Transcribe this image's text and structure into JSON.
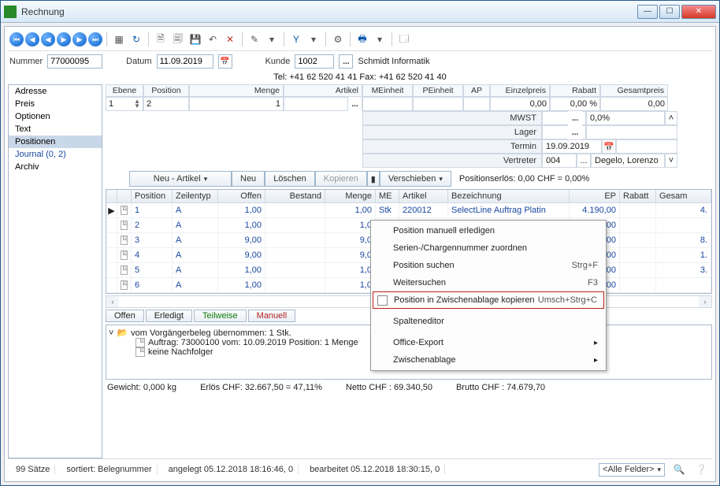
{
  "window": {
    "title": "Rechnung"
  },
  "toolbar": {
    "nav": [
      "⏮",
      "◀",
      "◀",
      "▶",
      "▶",
      "⏭"
    ]
  },
  "header": {
    "nummer_label": "Nummer",
    "nummer_value": "77000095",
    "datum_label": "Datum",
    "datum_value": "11.09.2019",
    "kunde_label": "Kunde",
    "kunde_value": "1002",
    "kunde_name": "Schmidt Informatik",
    "contact": "Tel: +41 62 520 41 41   Fax: +41 62 520 41 40"
  },
  "sidebar": {
    "items": [
      "Adresse",
      "Preis",
      "Optionen",
      "Text",
      "Positionen",
      "Journal (0, 2)",
      "Archiv"
    ],
    "selected_index": 4
  },
  "posheaders": [
    "Ebene",
    "Position",
    "Menge",
    "Artikel",
    "MEinheit",
    "PEinheit",
    "AP",
    "Einzelpreis",
    "Rabatt",
    "Gesamtpreis"
  ],
  "inputrow": {
    "ebene": "1",
    "position": "2",
    "menge": "1",
    "einzelpreis": "0,00",
    "rabatt": "0,00 %",
    "gesamtpreis": "0,00"
  },
  "subrows": {
    "mwst_label": "MWST",
    "mwst_value": "0,0%",
    "lager_label": "Lager",
    "termin_label": "Termin",
    "termin_value": "19.09.2019",
    "vertreter_label": "Vertreter",
    "vertreter_value": "004",
    "vertreter_name": "Degelo, Lorenzo"
  },
  "btnbar": {
    "neu_artikel": "Neu - Artikel",
    "neu": "Neu",
    "loeschen": "Löschen",
    "kopieren": "Kopieren",
    "verschieben": "Verschieben",
    "erlös": "Positionserlös:  0,00 CHF = 0,00%"
  },
  "gridheaders": [
    "Position",
    "Zeilentyp",
    "Offen",
    "Bestand",
    "Menge",
    "ME",
    "Artikel",
    "Bezeichnung",
    "EP",
    "Rabatt",
    "Gesam"
  ],
  "gridrows": [
    {
      "pos": "1",
      "typ": "A",
      "offen": "1,00",
      "bestand": "",
      "menge": "1,00",
      "me": "Stk",
      "artikel": "220012",
      "bez": "SelectLine Auftrag Platin",
      "ep": "4.190,00",
      "rabatt": "",
      "gesam": "4."
    },
    {
      "pos": "2",
      "typ": "A",
      "offen": "1,00",
      "bestand": "",
      "menge": "1,0",
      "me": "",
      "artikel": "",
      "bez": "",
      "ep": "00",
      "rabatt": "",
      "gesam": ""
    },
    {
      "pos": "3",
      "typ": "A",
      "offen": "9,00",
      "bestand": "",
      "menge": "9,0",
      "me": "",
      "artikel": "",
      "bez": "",
      "ep": "00",
      "rabatt": "",
      "gesam": "8."
    },
    {
      "pos": "4",
      "typ": "A",
      "offen": "9,00",
      "bestand": "",
      "menge": "9,0",
      "me": "",
      "artikel": "",
      "bez": "",
      "ep": "00",
      "rabatt": "",
      "gesam": "1."
    },
    {
      "pos": "5",
      "typ": "A",
      "offen": "1,00",
      "bestand": "",
      "menge": "1,0",
      "me": "",
      "artikel": "",
      "bez": "",
      "ep": "00",
      "rabatt": "",
      "gesam": "3."
    },
    {
      "pos": "6",
      "typ": "A",
      "offen": "1,00",
      "bestand": "",
      "menge": "1,0",
      "me": "",
      "artikel": "",
      "bez": "",
      "ep": "00",
      "rabatt": "",
      "gesam": ""
    }
  ],
  "tabs": {
    "offen": "Offen",
    "erledigt": "Erledigt",
    "teilweise": "Teilweise",
    "manuell": "Manuell"
  },
  "tree": {
    "line1": "vom Vorgängerbeleg übernommen: 1 Stk.",
    "line2": "Auftrag: 73000100 vom: 10.09.2019 Position: 1 Menge",
    "line3": "keine Nachfolger"
  },
  "footer": {
    "gewicht": "Gewicht:  0,000 kg",
    "erlos": "Erlös CHF:  32.667,50 = 47,11%",
    "netto": "Netto CHF :  69.340,50",
    "brutto": "Brutto CHF :  74.679,70"
  },
  "statusbar": {
    "count": "99 Sätze",
    "sort": "sortiert: Belegnummer",
    "angelegt": "angelegt 05.12.2018 18:16:46,  0",
    "bearbeitet": "bearbeitet 05.12.2018 18:30:15,  0",
    "filter": "<Alle Felder>"
  },
  "contextmenu": {
    "items": [
      {
        "label": "Position manuell erledigen",
        "shortcut": ""
      },
      {
        "label": "Serien-/Chargennummer zuordnen",
        "shortcut": ""
      },
      {
        "label": "Position suchen",
        "shortcut": "Strg+F"
      },
      {
        "label": "Weitersuchen",
        "shortcut": "F3"
      },
      {
        "label": "Position in Zwischenablage kopieren",
        "shortcut": "Umsch+Strg+C",
        "highlight": true,
        "icon": true
      },
      {
        "divider": true
      },
      {
        "label": "Spalteneditor",
        "shortcut": ""
      },
      {
        "divider": true
      },
      {
        "label": "Office-Export",
        "shortcut": "",
        "submenu": true
      },
      {
        "label": "Zwischenablage",
        "shortcut": "",
        "submenu": true
      }
    ]
  }
}
